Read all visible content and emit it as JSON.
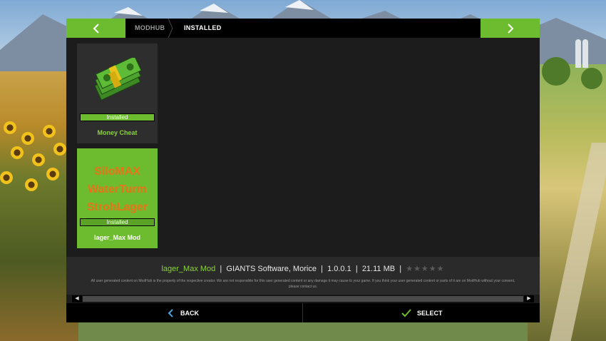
{
  "header": {
    "breadcrumb": [
      "MODHUB",
      "INSTALLED"
    ]
  },
  "mods": [
    {
      "title": "Money Cheat",
      "status": "Installed",
      "icon": "money-stack-icon"
    },
    {
      "title": "lager_Max Mod",
      "status": "Installed",
      "image_text": [
        "SiloMAX",
        "WaterTurm",
        "StrohLager"
      ]
    }
  ],
  "info": {
    "mod_name": "lager_Max Mod",
    "author": "GIANTS Software, Morice",
    "version": "1.0.0.1",
    "size": "21.11 MB",
    "rating_stars": 0,
    "separator": "|",
    "disclaimer": "All user generated content on ModHub is the property of the respective creator. We are not responsible for this user generated content or any damage it may cause to your game. If you think your user generated content or parts of it are on ModHub without your consent, please contact us."
  },
  "footer": {
    "back_label": "BACK",
    "select_label": "SELECT"
  },
  "colors": {
    "accent": "#6dbb2e",
    "panel": "#1c1c1c",
    "orange_text": "#e8741a"
  }
}
